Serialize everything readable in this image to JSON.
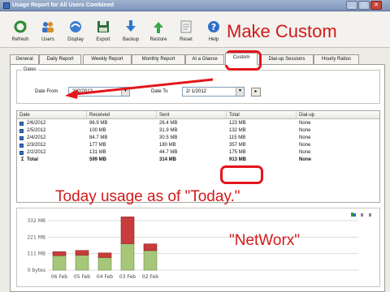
{
  "window": {
    "title": "Usage Report for All Users Combined",
    "controls": [
      "_",
      "□",
      "✕"
    ]
  },
  "toolbar": {
    "buttons": [
      {
        "label": "Refresh",
        "icon": "refresh-icon"
      },
      {
        "label": "Users",
        "icon": "users-icon"
      },
      {
        "label": "Display",
        "icon": "display-icon"
      },
      {
        "label": "Export",
        "icon": "export-icon"
      },
      {
        "label": "Backup",
        "icon": "backup-icon"
      },
      {
        "label": "Restore",
        "icon": "restore-icon"
      },
      {
        "label": "Reset",
        "icon": "reset-icon"
      },
      {
        "label": "Help",
        "icon": "help-icon"
      }
    ]
  },
  "tabs": [
    "General",
    "Daily Report",
    "Weekly Report",
    "Monthly Report",
    "At a Glance",
    "Custom",
    "Dial-up Sessions",
    "Hourly Ratios"
  ],
  "active_tab": "Custom",
  "dates": {
    "group_label": "Dates",
    "from_label": "Date From",
    "from_value": "2/ 2/2012",
    "to_label": "Date To",
    "to_value": "2/ 1/2012",
    "step_button": "▸"
  },
  "table": {
    "columns": [
      "Date",
      "Received",
      "Sent",
      "Total",
      "Dial-up"
    ],
    "rows": [
      [
        "2/6/2012",
        "96.9 MB",
        "26.4 MB",
        "123 MB",
        "None"
      ],
      [
        "2/5/2012",
        "100 MB",
        "31.9 MB",
        "132 MB",
        "None"
      ],
      [
        "2/4/2012",
        "84.7 MB",
        "30.5 MB",
        "115 MB",
        "None"
      ],
      [
        "2/3/2012",
        "177 MB",
        "180 MB",
        "357 MB",
        "None"
      ],
      [
        "2/2/2012",
        "131 MB",
        "44.7 MB",
        "175 MB",
        "None"
      ]
    ],
    "total_row": [
      "Total",
      "599 MB",
      "314 MB",
      "913 MB",
      "None"
    ]
  },
  "chart_data": {
    "type": "bar",
    "categories": [
      "06 Feb",
      "05 Feb",
      "04 Feb",
      "03 Feb",
      "02 Feb"
    ],
    "series": [
      {
        "name": "Received",
        "values": [
          96.9,
          100,
          84.7,
          177,
          131
        ]
      },
      {
        "name": "Sent",
        "values": [
          26.4,
          31.9,
          30.5,
          180,
          44.7
        ]
      }
    ],
    "stacked": true,
    "ytick_labels": [
      "332 MB",
      "221 MB",
      "111 MB",
      "0 bytes"
    ],
    "ylim": [
      0,
      370
    ],
    "grid": true,
    "colors": {
      "received": "#a6c67a",
      "sent": "#c83c3c"
    }
  },
  "annotations": {
    "make_custom": "Make Custom",
    "today_usage": "Today usage as of \"Today.\"",
    "networx": "\"NetWorx\""
  }
}
